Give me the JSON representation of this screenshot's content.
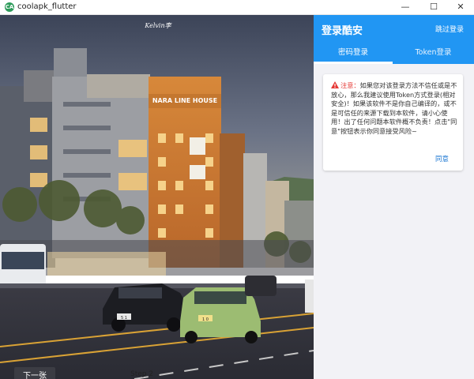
{
  "window": {
    "app_icon_text": "CA",
    "title": "coolapk_flutter",
    "min": "—",
    "max": "☐",
    "close": "✕"
  },
  "photo": {
    "watermark": "Kelvin李",
    "sign_hotel": "NARA LINE HOUSE",
    "plate_left": "5 1",
    "plate_car": "1 0",
    "next_label": "下一张",
    "step_label": "Step 2"
  },
  "login": {
    "title": "登录酷安",
    "skip": "跳过登录",
    "tabs": [
      "密码登录",
      "Token登录"
    ],
    "active_tab": 0,
    "notice_prefix": "注意：",
    "notice_body": "如果您对该登录方法不信任或是不放心，那么我建议使用Token方式登录(相对安全)！如果该软件不是你自己编译的，或不是可信任的来源下载到本软件，请小心使用！出了任何问题本软件概不负责！点击\"同意\"按钮表示你同意接受风险~",
    "agree": "同意"
  },
  "colors": {
    "primary": "#2196f3",
    "warning": "#e53935",
    "link": "#1976d2",
    "panel_bg": "#f2f2f6"
  }
}
